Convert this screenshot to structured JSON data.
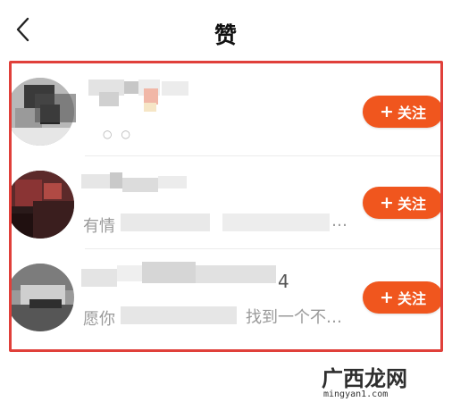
{
  "header": {
    "title": "赞",
    "back_icon": "chevron-left-icon"
  },
  "accent_color": "#f0561e",
  "highlight_color": "#e0403a",
  "likes": [
    {
      "name": "",
      "subtitle": "",
      "follow_label": "关注",
      "follow_icon": "plus-icon"
    },
    {
      "name": "",
      "subtitle_prefix": "有情",
      "subtitle_suffix": "…",
      "follow_label": "关注",
      "follow_icon": "plus-icon"
    },
    {
      "name_suffix": "4",
      "subtitle_prefix": "愿你",
      "subtitle_suffix": "找到一个不…",
      "follow_label": "关注",
      "follow_icon": "plus-icon"
    }
  ],
  "watermark": {
    "text": "广西龙网",
    "url": "mingyan1.com"
  }
}
